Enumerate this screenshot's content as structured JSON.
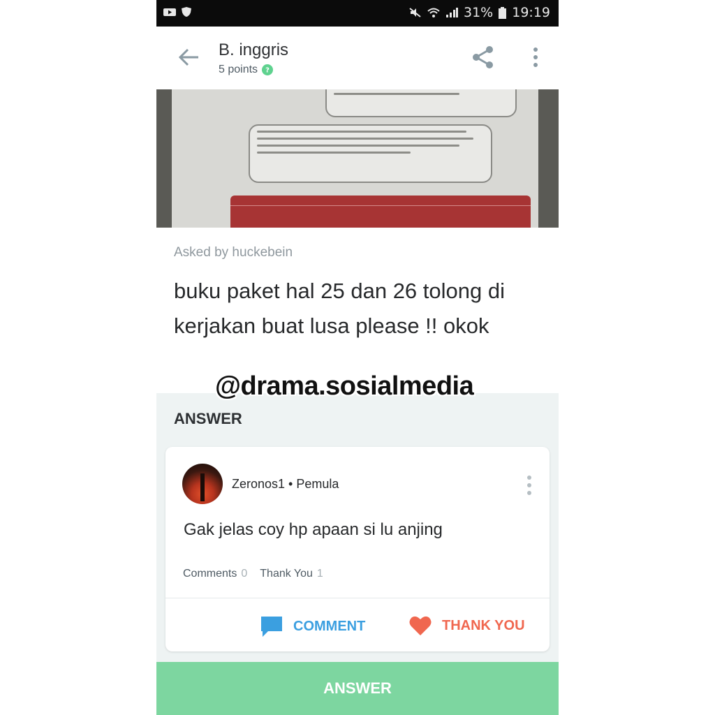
{
  "status_bar": {
    "battery": "31%",
    "time": "19:19"
  },
  "header": {
    "title": "B. inggris",
    "points": "5 points"
  },
  "question": {
    "asked_by": "Asked by huckebein",
    "text": "buku paket hal 25 dan 26 tolong di kerjakan buat lusa please !! okok"
  },
  "watermark": "@drama.sosialmedia",
  "answer_section": {
    "label": "ANSWER",
    "card": {
      "author": "Zeronos1",
      "rank": "Pemula",
      "text": "Gak jelas coy hp apaan si lu anjing",
      "comments_label": "Comments",
      "comments_count": "0",
      "thanks_label": "Thank You",
      "thanks_count": "1",
      "comment_button": "COMMENT",
      "thank_button": "THANK YOU"
    }
  },
  "bottom_button": "ANSWER",
  "colors": {
    "accent_green": "#7dd6a0",
    "comment_blue": "#3b9fe0",
    "thanks_red": "#f0674f"
  }
}
